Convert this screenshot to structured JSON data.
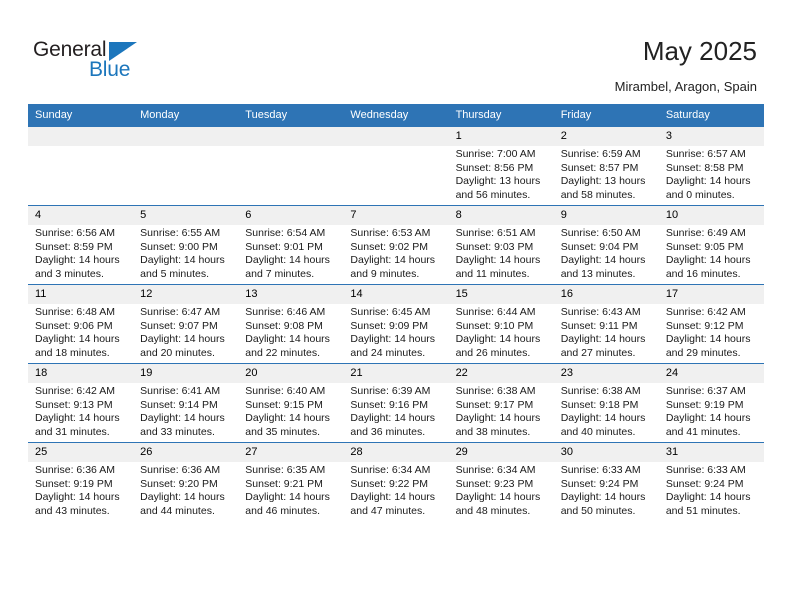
{
  "brand": {
    "name_top": "General",
    "name_bottom": "Blue",
    "accent_color": "#1c76bc",
    "triangle_icon": "triangle-icon"
  },
  "header": {
    "title": "May 2025",
    "subtitle": "Mirambel, Aragon, Spain"
  },
  "calendar": {
    "header_bg": "#2e74b5",
    "daynum_bg": "#f0f0f0",
    "weekdays": [
      "Sunday",
      "Monday",
      "Tuesday",
      "Wednesday",
      "Thursday",
      "Friday",
      "Saturday"
    ],
    "weeks": [
      [
        {
          "day": "",
          "empty": true,
          "sunrise": "",
          "sunset": "",
          "daylight1": "",
          "daylight2": ""
        },
        {
          "day": "",
          "empty": true,
          "sunrise": "",
          "sunset": "",
          "daylight1": "",
          "daylight2": ""
        },
        {
          "day": "",
          "empty": true,
          "sunrise": "",
          "sunset": "",
          "daylight1": "",
          "daylight2": ""
        },
        {
          "day": "",
          "empty": true,
          "sunrise": "",
          "sunset": "",
          "daylight1": "",
          "daylight2": ""
        },
        {
          "day": "1",
          "sunrise": "Sunrise: 7:00 AM",
          "sunset": "Sunset: 8:56 PM",
          "daylight1": "Daylight: 13 hours",
          "daylight2": "and 56 minutes."
        },
        {
          "day": "2",
          "sunrise": "Sunrise: 6:59 AM",
          "sunset": "Sunset: 8:57 PM",
          "daylight1": "Daylight: 13 hours",
          "daylight2": "and 58 minutes."
        },
        {
          "day": "3",
          "sunrise": "Sunrise: 6:57 AM",
          "sunset": "Sunset: 8:58 PM",
          "daylight1": "Daylight: 14 hours",
          "daylight2": "and 0 minutes."
        }
      ],
      [
        {
          "day": "4",
          "sunrise": "Sunrise: 6:56 AM",
          "sunset": "Sunset: 8:59 PM",
          "daylight1": "Daylight: 14 hours",
          "daylight2": "and 3 minutes."
        },
        {
          "day": "5",
          "sunrise": "Sunrise: 6:55 AM",
          "sunset": "Sunset: 9:00 PM",
          "daylight1": "Daylight: 14 hours",
          "daylight2": "and 5 minutes."
        },
        {
          "day": "6",
          "sunrise": "Sunrise: 6:54 AM",
          "sunset": "Sunset: 9:01 PM",
          "daylight1": "Daylight: 14 hours",
          "daylight2": "and 7 minutes."
        },
        {
          "day": "7",
          "sunrise": "Sunrise: 6:53 AM",
          "sunset": "Sunset: 9:02 PM",
          "daylight1": "Daylight: 14 hours",
          "daylight2": "and 9 minutes."
        },
        {
          "day": "8",
          "sunrise": "Sunrise: 6:51 AM",
          "sunset": "Sunset: 9:03 PM",
          "daylight1": "Daylight: 14 hours",
          "daylight2": "and 11 minutes."
        },
        {
          "day": "9",
          "sunrise": "Sunrise: 6:50 AM",
          "sunset": "Sunset: 9:04 PM",
          "daylight1": "Daylight: 14 hours",
          "daylight2": "and 13 minutes."
        },
        {
          "day": "10",
          "sunrise": "Sunrise: 6:49 AM",
          "sunset": "Sunset: 9:05 PM",
          "daylight1": "Daylight: 14 hours",
          "daylight2": "and 16 minutes."
        }
      ],
      [
        {
          "day": "11",
          "sunrise": "Sunrise: 6:48 AM",
          "sunset": "Sunset: 9:06 PM",
          "daylight1": "Daylight: 14 hours",
          "daylight2": "and 18 minutes."
        },
        {
          "day": "12",
          "sunrise": "Sunrise: 6:47 AM",
          "sunset": "Sunset: 9:07 PM",
          "daylight1": "Daylight: 14 hours",
          "daylight2": "and 20 minutes."
        },
        {
          "day": "13",
          "sunrise": "Sunrise: 6:46 AM",
          "sunset": "Sunset: 9:08 PM",
          "daylight1": "Daylight: 14 hours",
          "daylight2": "and 22 minutes."
        },
        {
          "day": "14",
          "sunrise": "Sunrise: 6:45 AM",
          "sunset": "Sunset: 9:09 PM",
          "daylight1": "Daylight: 14 hours",
          "daylight2": "and 24 minutes."
        },
        {
          "day": "15",
          "sunrise": "Sunrise: 6:44 AM",
          "sunset": "Sunset: 9:10 PM",
          "daylight1": "Daylight: 14 hours",
          "daylight2": "and 26 minutes."
        },
        {
          "day": "16",
          "sunrise": "Sunrise: 6:43 AM",
          "sunset": "Sunset: 9:11 PM",
          "daylight1": "Daylight: 14 hours",
          "daylight2": "and 27 minutes."
        },
        {
          "day": "17",
          "sunrise": "Sunrise: 6:42 AM",
          "sunset": "Sunset: 9:12 PM",
          "daylight1": "Daylight: 14 hours",
          "daylight2": "and 29 minutes."
        }
      ],
      [
        {
          "day": "18",
          "sunrise": "Sunrise: 6:42 AM",
          "sunset": "Sunset: 9:13 PM",
          "daylight1": "Daylight: 14 hours",
          "daylight2": "and 31 minutes."
        },
        {
          "day": "19",
          "sunrise": "Sunrise: 6:41 AM",
          "sunset": "Sunset: 9:14 PM",
          "daylight1": "Daylight: 14 hours",
          "daylight2": "and 33 minutes."
        },
        {
          "day": "20",
          "sunrise": "Sunrise: 6:40 AM",
          "sunset": "Sunset: 9:15 PM",
          "daylight1": "Daylight: 14 hours",
          "daylight2": "and 35 minutes."
        },
        {
          "day": "21",
          "sunrise": "Sunrise: 6:39 AM",
          "sunset": "Sunset: 9:16 PM",
          "daylight1": "Daylight: 14 hours",
          "daylight2": "and 36 minutes."
        },
        {
          "day": "22",
          "sunrise": "Sunrise: 6:38 AM",
          "sunset": "Sunset: 9:17 PM",
          "daylight1": "Daylight: 14 hours",
          "daylight2": "and 38 minutes."
        },
        {
          "day": "23",
          "sunrise": "Sunrise: 6:38 AM",
          "sunset": "Sunset: 9:18 PM",
          "daylight1": "Daylight: 14 hours",
          "daylight2": "and 40 minutes."
        },
        {
          "day": "24",
          "sunrise": "Sunrise: 6:37 AM",
          "sunset": "Sunset: 9:19 PM",
          "daylight1": "Daylight: 14 hours",
          "daylight2": "and 41 minutes."
        }
      ],
      [
        {
          "day": "25",
          "sunrise": "Sunrise: 6:36 AM",
          "sunset": "Sunset: 9:19 PM",
          "daylight1": "Daylight: 14 hours",
          "daylight2": "and 43 minutes."
        },
        {
          "day": "26",
          "sunrise": "Sunrise: 6:36 AM",
          "sunset": "Sunset: 9:20 PM",
          "daylight1": "Daylight: 14 hours",
          "daylight2": "and 44 minutes."
        },
        {
          "day": "27",
          "sunrise": "Sunrise: 6:35 AM",
          "sunset": "Sunset: 9:21 PM",
          "daylight1": "Daylight: 14 hours",
          "daylight2": "and 46 minutes."
        },
        {
          "day": "28",
          "sunrise": "Sunrise: 6:34 AM",
          "sunset": "Sunset: 9:22 PM",
          "daylight1": "Daylight: 14 hours",
          "daylight2": "and 47 minutes."
        },
        {
          "day": "29",
          "sunrise": "Sunrise: 6:34 AM",
          "sunset": "Sunset: 9:23 PM",
          "daylight1": "Daylight: 14 hours",
          "daylight2": "and 48 minutes."
        },
        {
          "day": "30",
          "sunrise": "Sunrise: 6:33 AM",
          "sunset": "Sunset: 9:24 PM",
          "daylight1": "Daylight: 14 hours",
          "daylight2": "and 50 minutes."
        },
        {
          "day": "31",
          "sunrise": "Sunrise: 6:33 AM",
          "sunset": "Sunset: 9:24 PM",
          "daylight1": "Daylight: 14 hours",
          "daylight2": "and 51 minutes."
        }
      ]
    ]
  }
}
